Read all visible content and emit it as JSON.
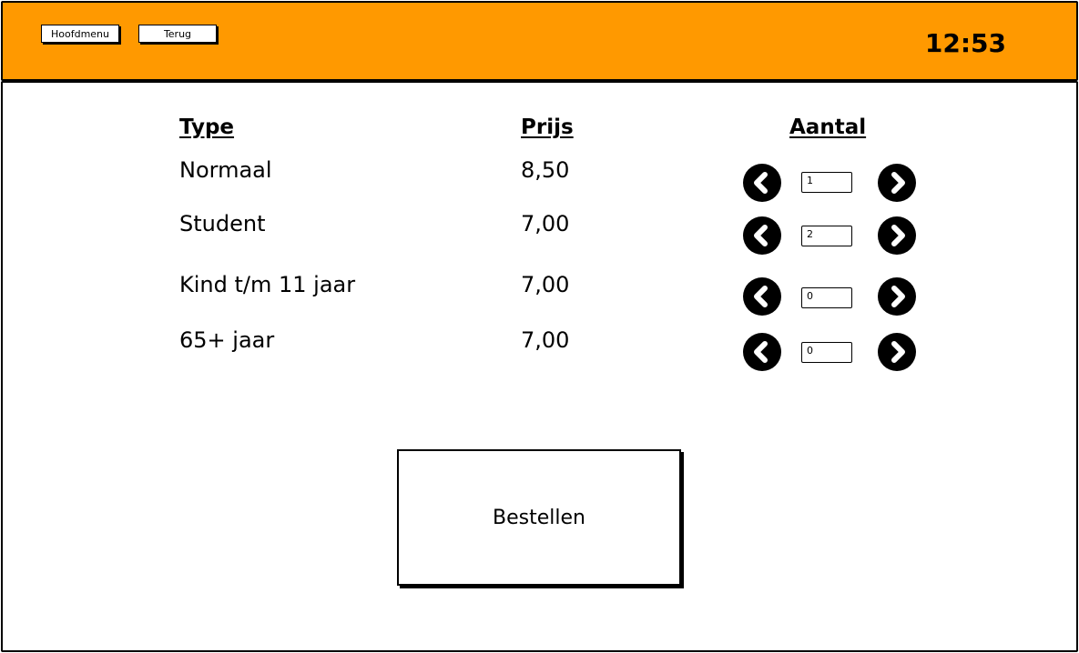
{
  "header": {
    "menu_label": "Hoofdmenu",
    "back_label": "Terug",
    "time": "12:53",
    "background_color": "#ff9900"
  },
  "table": {
    "headers": {
      "type": "Type",
      "price": "Prijs",
      "count": "Aantal"
    },
    "rows": [
      {
        "type": "Normaal",
        "price": "8,50",
        "count": "1"
      },
      {
        "type": "Student",
        "price": "7,00",
        "count": "2"
      },
      {
        "type": "Kind t/m 11 jaar",
        "price": "7,00",
        "count": "0"
      },
      {
        "type": "65+ jaar",
        "price": "7,00",
        "count": "0"
      }
    ],
    "decrease_icon": "chevron-left-icon",
    "increase_icon": "chevron-right-icon"
  },
  "order_button_label": "Bestellen"
}
